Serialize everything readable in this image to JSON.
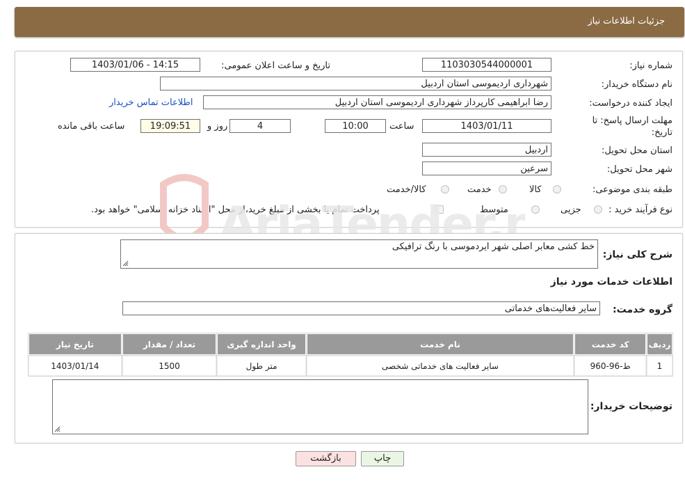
{
  "header": {
    "title": "جزئیات اطلاعات نیاز"
  },
  "details": {
    "need_number_label": "شماره نیاز:",
    "need_number": "1103030544000001",
    "announce_label": "تاریخ و ساعت اعلان عمومی:",
    "announce_value": "1403/01/06 - 14:15",
    "buyer_org_label": "نام دستگاه خریدار:",
    "buyer_org": "شهرداری اردیموسی استان اردبیل",
    "creator_label": "ایجاد کننده درخواست:",
    "creator": "رضا ابراهیمی کارپرداز شهرداری اردیموسی استان اردبیل",
    "contact_link": "اطلاعات تماس خریدار",
    "deadline_label_1": "مهلت ارسال پاسخ: تا",
    "deadline_label_2": "تاریخ:",
    "deadline_date": "1403/01/11",
    "time_label": "ساعت",
    "deadline_time": "10:00",
    "days_value": "4",
    "days_label": "روز و",
    "remaining_time": "19:09:51",
    "remaining_label": "ساعت باقی مانده",
    "province_label": "استان محل تحویل:",
    "province": "اردبیل",
    "city_label": "شهر محل تحویل:",
    "city": "سرعین",
    "category_label": "طبقه بندی موضوعی:",
    "category_options": [
      "کالا",
      "خدمت",
      "کالا/خدمت"
    ],
    "process_label": "نوع فرآیند خرید :",
    "process_options": [
      "جزیی",
      "متوسط"
    ],
    "payment_note": "پرداخت تمام یا بخشی از مبلغ خرید،از محل \"اسناد خزانه اسلامی\" خواهد بود."
  },
  "services": {
    "summary_label": "شرح کلی نیاز:",
    "summary_value": "خط کشی معابر اصلی شهر ایردموسی با رنگ ترافیکی",
    "section_title": "اطلاعات خدمات مورد نیاز",
    "group_label": "گروه خدمت:",
    "group_value": "سایر فعالیت‌های خدماتی",
    "table": {
      "headers": [
        "ردیف",
        "کد خدمت",
        "نام خدمت",
        "واحد اندازه گیری",
        "تعداد / مقدار",
        "تاریخ نیاز"
      ],
      "rows": [
        [
          "1",
          "ط-96-960",
          "سایر فعالیت های خدماتی شخصی",
          "متر طول",
          "1500",
          "1403/01/14"
        ]
      ]
    },
    "buyer_notes_label": "توضیحات خریدار:",
    "buyer_notes_value": ""
  },
  "buttons": {
    "print": "چاپ",
    "back": "بازگشت"
  },
  "watermark": {
    "text": "AriaTender.neT",
    "color": "#d9534f"
  }
}
